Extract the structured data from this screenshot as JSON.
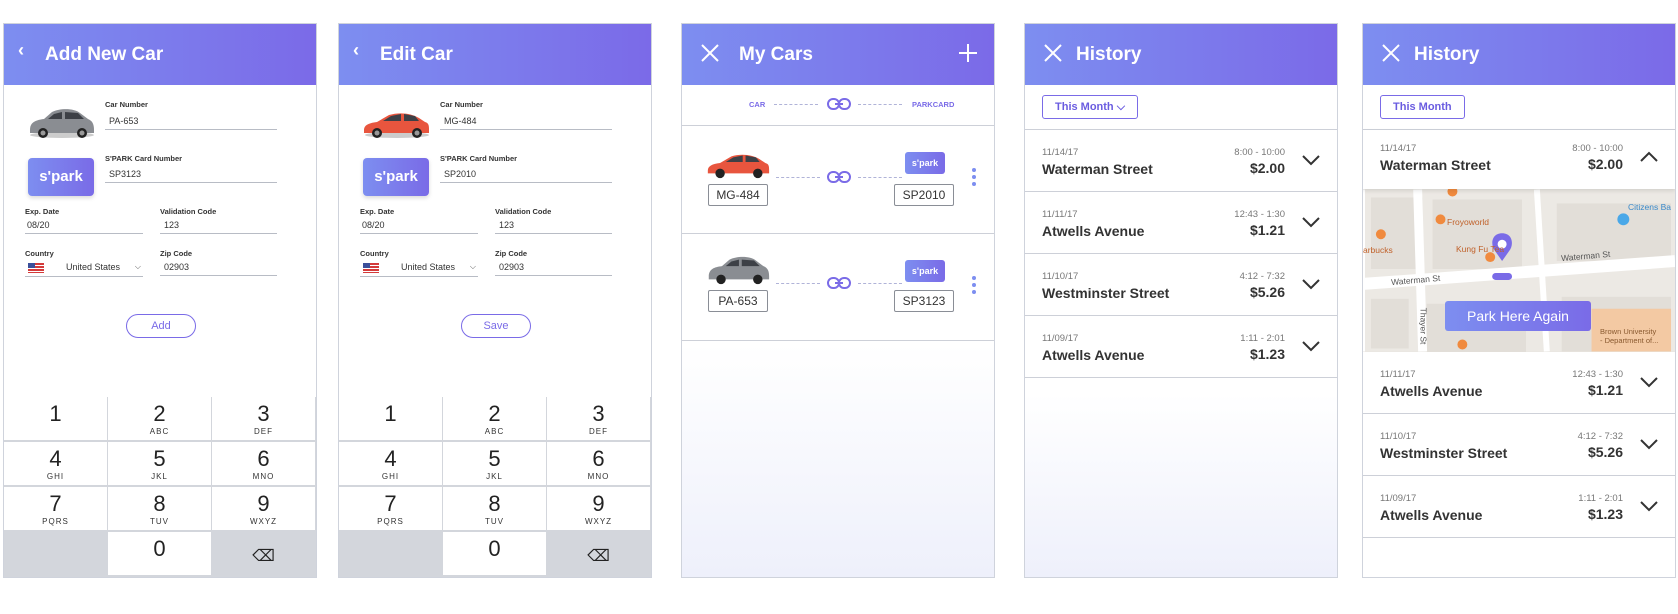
{
  "screens": {
    "add": {
      "title": "Add New Car",
      "car_number_label": "Car Number",
      "car_number": "PA-653",
      "card_label": "S'PARK Card Number",
      "card_number": "SP3123",
      "logo": "s'park",
      "exp_label": "Exp. Date",
      "exp_value": "08/20",
      "valid_label": "Validation Code",
      "valid_value": "123",
      "country_label": "Country",
      "country_value": "United States",
      "zip_label": "Zip Code",
      "zip_value": "02903",
      "button": "Add",
      "car_color": "#8a8d92"
    },
    "edit": {
      "title": "Edit Car",
      "car_number_label": "Car Number",
      "car_number": "MG-484",
      "card_label": "S'PARK Card Number",
      "card_number": "SP2010",
      "logo": "s'park",
      "exp_label": "Exp. Date",
      "exp_value": "08/20",
      "valid_label": "Validation Code",
      "valid_value": "123",
      "country_label": "Country",
      "country_value": "United States",
      "zip_label": "Zip Code",
      "zip_value": "02903",
      "button": "Save",
      "car_color": "#e8553e"
    },
    "keypad": [
      {
        "n": "1",
        "l": ""
      },
      {
        "n": "2",
        "l": "ABC"
      },
      {
        "n": "3",
        "l": "DEF"
      },
      {
        "n": "4",
        "l": "GHI"
      },
      {
        "n": "5",
        "l": "JKL"
      },
      {
        "n": "6",
        "l": "MNO"
      },
      {
        "n": "7",
        "l": "PQRS"
      },
      {
        "n": "8",
        "l": "TUV"
      },
      {
        "n": "9",
        "l": "WXYZ"
      },
      {
        "n": "",
        "l": ""
      },
      {
        "n": "0",
        "l": ""
      },
      {
        "n": "⌫",
        "l": ""
      }
    ],
    "mycars": {
      "title": "My Cars",
      "col_car": "CAR",
      "col_card": "PARKCARD",
      "cars": [
        {
          "plate": "MG-484",
          "card": "SP2010",
          "badge": "s'park",
          "color": "#e8553e"
        },
        {
          "plate": "PA-653",
          "card": "SP3123",
          "badge": "s'park",
          "color": "#8a8d92"
        }
      ]
    },
    "history": {
      "title": "History",
      "filter": "This Month",
      "rows": [
        {
          "date": "11/14/17",
          "street": "Waterman Street",
          "time": "8:00 - 10:00",
          "price": "$2.00"
        },
        {
          "date": "11/11/17",
          "street": "Atwells Avenue",
          "time": "12:43 - 1:30",
          "price": "$1.21"
        },
        {
          "date": "11/10/17",
          "street": "Westminster Street",
          "time": "4:12 - 7:32",
          "price": "$5.26"
        },
        {
          "date": "11/09/17",
          "street": "Atwells Avenue",
          "time": "1:11 - 2:01",
          "price": "$1.23"
        }
      ]
    },
    "history_map": {
      "title": "History",
      "filter": "This Month",
      "expanded": {
        "date": "11/14/17",
        "street": "Waterman Street",
        "time": "8:00 - 10:00",
        "price": "$2.00"
      },
      "rows": [
        {
          "date": "11/11/17",
          "street": "Atwells Avenue",
          "time": "12:43 - 1:30",
          "price": "$1.21"
        },
        {
          "date": "11/10/17",
          "street": "Westminster Street",
          "time": "4:12 - 7:32",
          "price": "$5.26"
        },
        {
          "date": "11/09/17",
          "street": "Atwells Avenue",
          "time": "1:11 - 2:01",
          "price": "$1.23"
        }
      ],
      "map": {
        "button": "Park Here Again",
        "labels": [
          "Froyoworld",
          "Kung Fu Tea",
          "Waterman St",
          "Waterman St",
          "Thayer St",
          "Citizens Ba",
          "arbucks",
          "Brown University",
          "- Department of..."
        ]
      }
    }
  }
}
